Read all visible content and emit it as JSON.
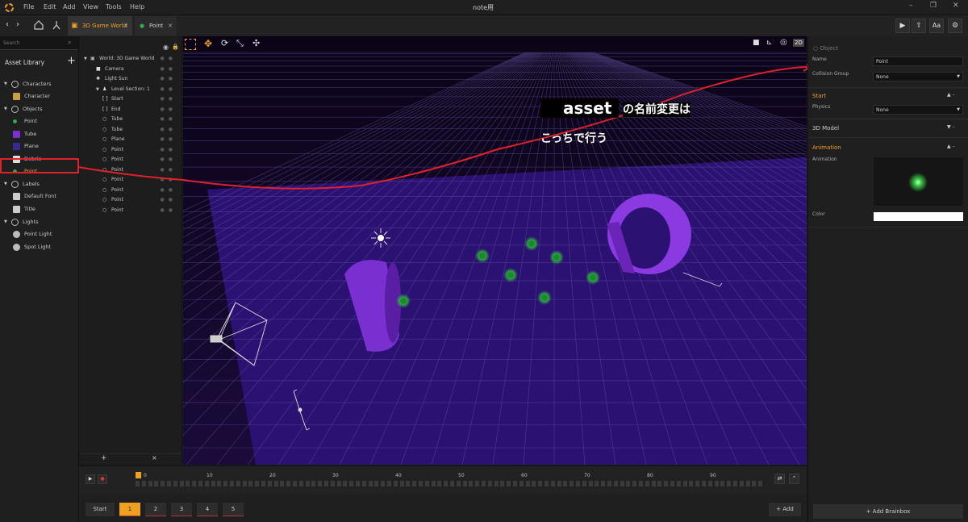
{
  "window": {
    "title": "note用",
    "menu": [
      "File",
      "Edit",
      "Add",
      "View",
      "Tools",
      "Help"
    ]
  },
  "tabs": [
    {
      "label": "3D Game World"
    },
    {
      "label": "Point"
    }
  ],
  "toolbar_right": {
    "font_label": "Aa"
  },
  "asset_library": {
    "search_placeholder": "Search",
    "title": "Asset Library",
    "add_label": "+",
    "items": [
      {
        "label": "Characters",
        "kind": "category",
        "icon": "person-icon"
      },
      {
        "label": "Character",
        "kind": "item",
        "icon": "character-icon"
      },
      {
        "label": "Objects",
        "kind": "category",
        "icon": "objects-icon"
      },
      {
        "label": "Point",
        "kind": "item",
        "icon": "point-icon"
      },
      {
        "label": "Tube",
        "kind": "item",
        "icon": "tube-icon"
      },
      {
        "label": "Plane",
        "kind": "item",
        "icon": "plane-icon"
      },
      {
        "label": "Debris",
        "kind": "item",
        "icon": "cube-icon"
      },
      {
        "label": "Point",
        "kind": "item",
        "icon": "point-icon",
        "selected": true
      },
      {
        "label": "Labels",
        "kind": "category",
        "icon": "label-icon"
      },
      {
        "label": "Default Font",
        "kind": "item",
        "icon": "font-icon"
      },
      {
        "label": "Title",
        "kind": "item",
        "icon": "font-icon"
      },
      {
        "label": "Lights",
        "kind": "category",
        "icon": "light-icon"
      },
      {
        "label": "Point Light",
        "kind": "item",
        "icon": "pin-icon"
      },
      {
        "label": "Spot Light",
        "kind": "item",
        "icon": "pin-icon"
      }
    ]
  },
  "scene_tree": {
    "items": [
      {
        "label": "World: 3D Game World",
        "level": 0,
        "icon": "world-icon"
      },
      {
        "label": "Camera",
        "level": 1,
        "icon": "camera-icon"
      },
      {
        "label": "Light Sun",
        "level": 1,
        "icon": "sun-icon"
      },
      {
        "label": "Level Section: 1",
        "level": 1,
        "icon": "person-icon"
      },
      {
        "label": "Start",
        "level": 2,
        "icon": "bracket-icon"
      },
      {
        "label": "End",
        "level": 2,
        "icon": "bracket-icon"
      },
      {
        "label": "Tube",
        "level": 2,
        "icon": "circle-icon"
      },
      {
        "label": "Tube",
        "level": 2,
        "icon": "circle-icon"
      },
      {
        "label": "Plane",
        "level": 2,
        "icon": "circle-icon"
      },
      {
        "label": "Point",
        "level": 2,
        "icon": "circle-icon"
      },
      {
        "label": "Point",
        "level": 2,
        "icon": "circle-icon"
      },
      {
        "label": "Point",
        "level": 2,
        "icon": "circle-icon"
      },
      {
        "label": "Point",
        "level": 2,
        "icon": "circle-icon"
      },
      {
        "label": "Point",
        "level": 2,
        "icon": "circle-icon"
      },
      {
        "label": "Point",
        "level": 2,
        "icon": "circle-icon"
      },
      {
        "label": "Point",
        "level": 2,
        "icon": "circle-icon"
      }
    ],
    "add_label": "+",
    "remove_label": "×"
  },
  "viewport": {
    "mode_label": "2D"
  },
  "annotation": {
    "line1_en": "asset",
    "line1_jp": "の名前変更は",
    "line2": "こっちで行う"
  },
  "inspector": {
    "object_header": "Object",
    "name_label": "Name",
    "name_value": "Point",
    "collision_label": "Collision Group",
    "collision_value": "None",
    "start_section": "Start",
    "physics_label": "Physics",
    "physics_value": "None",
    "model_section": "3D Model",
    "animation_section": "Animation",
    "animation_label": "Animation",
    "color_label": "Color",
    "add_brainbox": "+ Add Brainbox"
  },
  "timeline": {
    "ticks": [
      "0",
      "10",
      "20",
      "30",
      "40",
      "50",
      "60",
      "70",
      "80",
      "90"
    ]
  },
  "sections": {
    "start_label": "Start",
    "numbers": [
      "1",
      "2",
      "3",
      "4",
      "5"
    ],
    "add_label": "+ Add"
  },
  "colors": {
    "accent": "#f0a020",
    "highlight_red": "#e0202a",
    "grid_purple": "#3a1a8a",
    "tube_purple": "#7a2fd0",
    "glow_green": "#3ec84a"
  }
}
